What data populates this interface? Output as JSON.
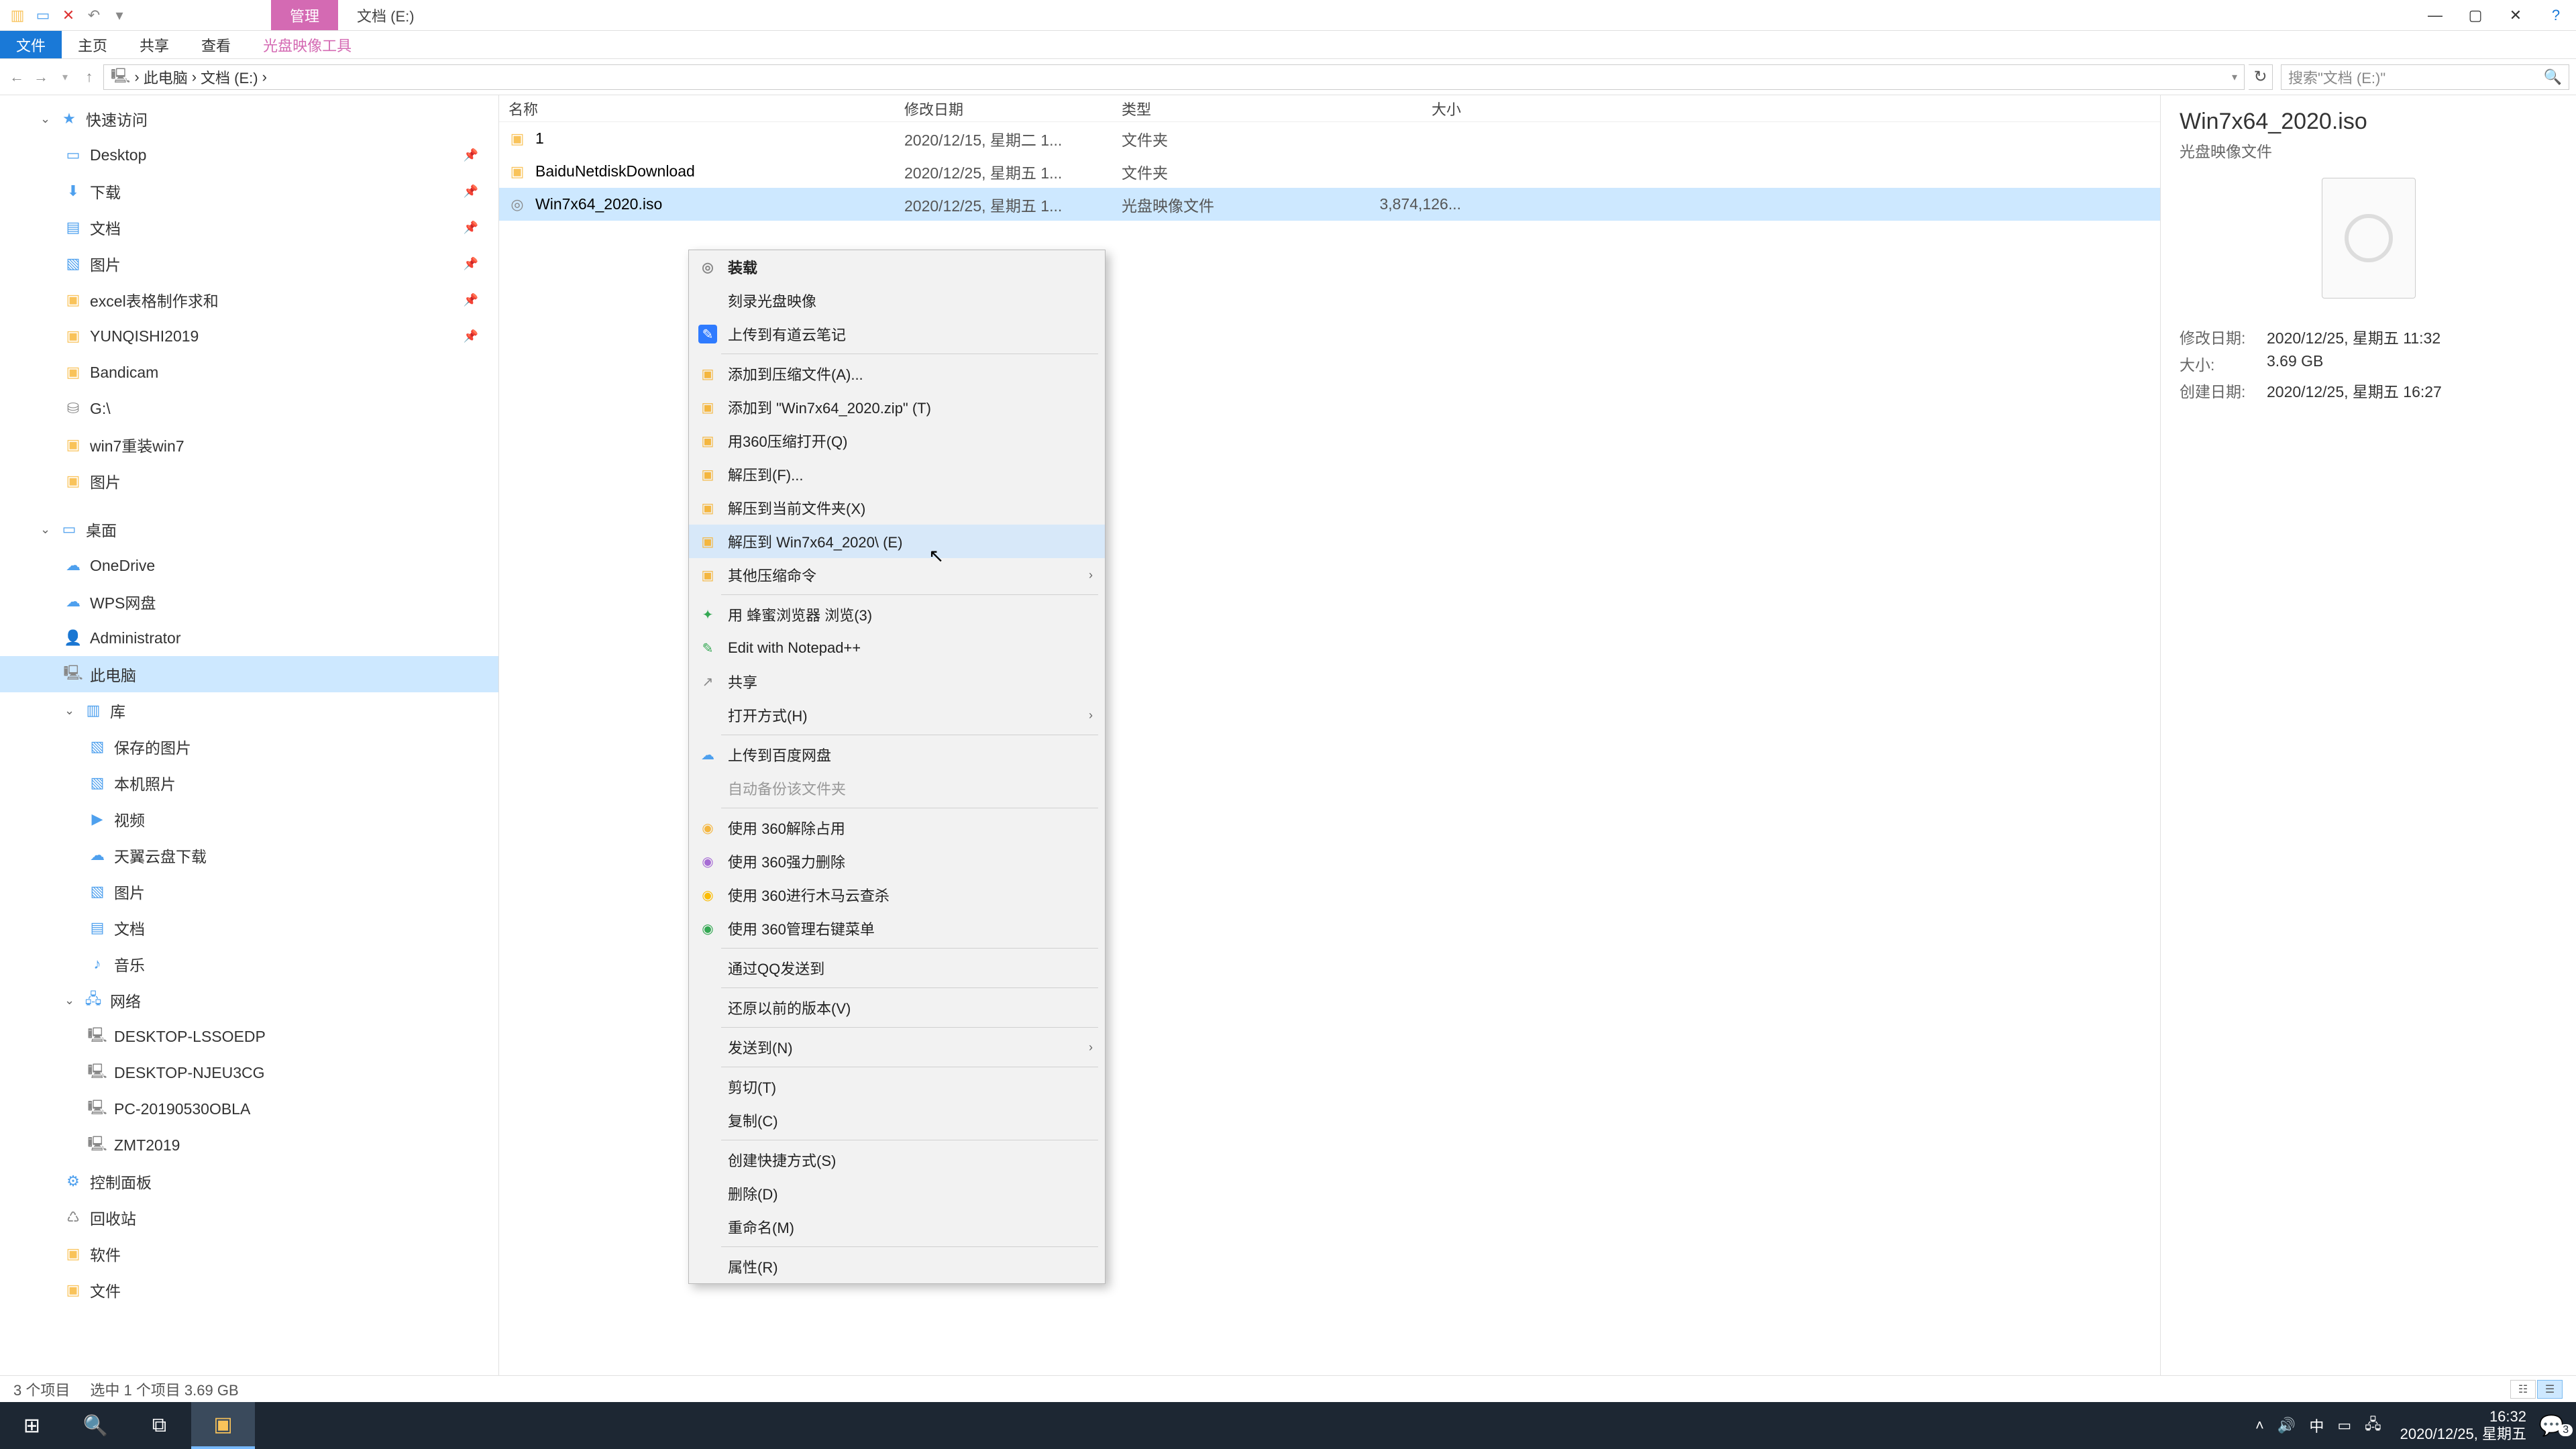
{
  "title": {
    "manage": "管理",
    "location": "文档 (E:)"
  },
  "ribbon": {
    "file": "文件",
    "home": "主页",
    "share": "共享",
    "view": "查看",
    "isotools": "光盘映像工具"
  },
  "addr": {
    "pc": "此电脑",
    "loc": "文档 (E:)",
    "search_ph": "搜索\"文档 (E:)\""
  },
  "tree": {
    "quick": "快速访问",
    "desktop": "Desktop",
    "downloads": "下载",
    "documents": "文档",
    "pictures": "图片",
    "excel": "excel表格制作求和",
    "yunqishi": "YUNQISHI2019",
    "bandicam": "Bandicam",
    "gdrive": "G:\\",
    "win7re": "win7重装win7",
    "pictures2": "图片",
    "desk": "桌面",
    "onedrive": "OneDrive",
    "wps": "WPS网盘",
    "admin": "Administrator",
    "thispc": "此电脑",
    "lib": "库",
    "savedpics": "保存的图片",
    "localpics": "本机照片",
    "videos": "视频",
    "tianyi": "天翼云盘下载",
    "pictures3": "图片",
    "docs3": "文档",
    "music": "音乐",
    "network": "网络",
    "d1": "DESKTOP-LSSOEDP",
    "d2": "DESKTOP-NJEU3CG",
    "d3": "PC-20190530OBLA",
    "d4": "ZMT2019",
    "cpanel": "控制面板",
    "recycle": "回收站",
    "soft": "软件",
    "files": "文件"
  },
  "cols": {
    "name": "名称",
    "date": "修改日期",
    "type": "类型",
    "size": "大小"
  },
  "rows": [
    {
      "icon": "folder",
      "name": "1",
      "date": "2020/12/15, 星期二 1...",
      "type": "文件夹",
      "size": ""
    },
    {
      "icon": "folder",
      "name": "BaiduNetdiskDownload",
      "date": "2020/12/25, 星期五 1...",
      "type": "文件夹",
      "size": ""
    },
    {
      "icon": "iso",
      "name": "Win7x64_2020.iso",
      "date": "2020/12/25, 星期五 1...",
      "type": "光盘映像文件",
      "size": "3,874,126..."
    }
  ],
  "details": {
    "name": "Win7x64_2020.iso",
    "type": "光盘映像文件",
    "k_mod": "修改日期:",
    "v_mod": "2020/12/25, 星期五 11:32",
    "k_size": "大小:",
    "v_size": "3.69 GB",
    "k_create": "创建日期:",
    "v_create": "2020/12/25, 星期五 16:27"
  },
  "ctx": {
    "mount": "装载",
    "burn": "刻录光盘映像",
    "youdao": "上传到有道云笔记",
    "addzip": "添加到压缩文件(A)...",
    "addzipn": "添加到 \"Win7x64_2020.zip\" (T)",
    "open360": "用360压缩打开(Q)",
    "extractto": "解压到(F)...",
    "extracthere": "解压到当前文件夹(X)",
    "extractname": "解压到 Win7x64_2020\\ (E)",
    "otherzip": "其他压缩命令",
    "bee": "用 蜂蜜浏览器 浏览(3)",
    "npp": "Edit with Notepad++",
    "share": "共享",
    "openwith": "打开方式(H)",
    "baidu": "上传到百度网盘",
    "autobak": "自动备份该文件夹",
    "u360_1": "使用 360解除占用",
    "u360_2": "使用 360强力删除",
    "u360_3": "使用 360进行木马云查杀",
    "u360_4": "使用 360管理右键菜单",
    "qq": "通过QQ发送到",
    "restore": "还原以前的版本(V)",
    "sendto": "发送到(N)",
    "cut": "剪切(T)",
    "copy": "复制(C)",
    "shortcut": "创建快捷方式(S)",
    "delete": "删除(D)",
    "rename": "重命名(M)",
    "prop": "属性(R)"
  },
  "status": {
    "count": "3 个项目",
    "sel": "选中 1 个项目  3.69 GB"
  },
  "taskbar": {
    "time": "16:32",
    "date": "2020/12/25, 星期五",
    "ime1": "中",
    "badge": "3"
  }
}
